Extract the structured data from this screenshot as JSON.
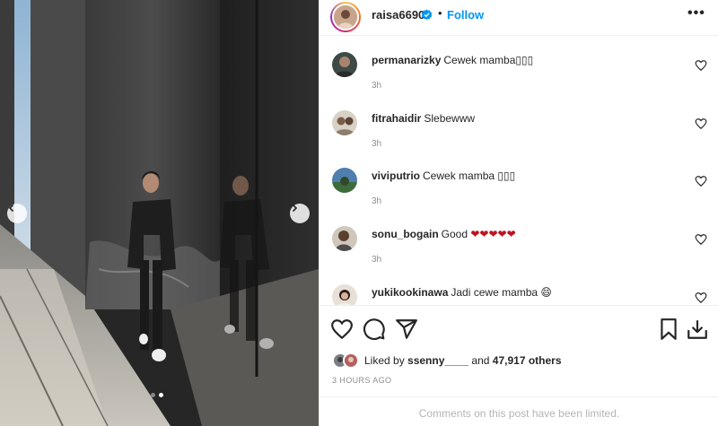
{
  "header": {
    "username": "raisa6690",
    "separator": "•",
    "follow_label": "Follow",
    "more_label": "•••"
  },
  "comments": [
    {
      "user": "permanarizky",
      "text": "Cewek mamba▯▯▯",
      "time": "3h"
    },
    {
      "user": "fitrahaidir",
      "text": "Slebewww",
      "time": "3h"
    },
    {
      "user": "viviputrio",
      "text": "Cewek mamba ▯▯▯",
      "time": "3h"
    },
    {
      "user": "sonu_bogain",
      "text": "Good ",
      "hearts": "❤❤❤❤❤",
      "time": "3h"
    },
    {
      "user": "yukikookinawa",
      "text": "Jadi cewe mamba ",
      "emoji": "😄",
      "time": ""
    }
  ],
  "likes": {
    "prefix": "Liked by ",
    "user": "ssenny____",
    "middle": " and ",
    "count": "47,917 others"
  },
  "timestamp": "3 HOURS AGO",
  "footer": {
    "limited_text": "Comments on this post have been limited."
  },
  "icons": {
    "like": "heart-icon",
    "comment": "comment-icon",
    "share": "share-icon",
    "save": "bookmark-icon",
    "download": "download-icon",
    "verified": "verified-badge-icon"
  },
  "colors": {
    "follow": "#0095f6",
    "verified": "#0095f6",
    "heart_emoji": "#c1121f",
    "muted": "#8e8e8e"
  },
  "carousel": {
    "slides": 2,
    "active_slide": 1
  }
}
